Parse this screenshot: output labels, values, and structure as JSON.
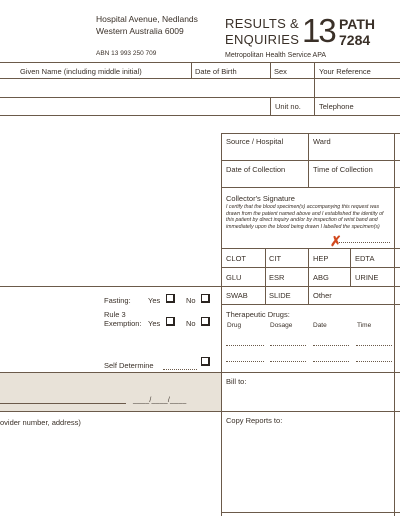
{
  "header": {
    "address_line1": "Hospital Avenue, Nedlands",
    "address_line2": "Western Australia 6009",
    "abn": "ABN 13 993 250 709",
    "title_line1": "RESULTS &",
    "title_line2": "ENQUIRIES",
    "big_number": "13",
    "path_label": "PATH",
    "path_number": "7284",
    "service": "Metropolitan Health Service APA"
  },
  "patient_row": {
    "given_name": "Given Name (including middle initial)",
    "dob": "Date of Birth",
    "sex": "Sex",
    "reference": "Your Reference",
    "unit_no": "Unit no.",
    "telephone": "Telephone"
  },
  "right_panel": {
    "source_hospital": "Source / Hospital",
    "ward": "Ward",
    "date_collection": "Date of Collection",
    "time_collection": "Time of Collection",
    "collector_signature": "Collector's Signature",
    "certify_text": "I certify that the blood specimen(s) accompanying this request was drawn from the patient named above and I established the identity of this patient by direct inquiry and/or by inspection of wrist band and immediately upon the blood being drawn I labelled the specimen(s)",
    "tubes": [
      "CLOT",
      "CIT",
      "HEP",
      "EDTA",
      "GLU",
      "ESR",
      "ABG",
      "URINE",
      "SWAB",
      "SLIDE",
      "Other"
    ],
    "therapeutic_drugs": "Therapeutic Drugs:",
    "drug_cols": [
      "Drug",
      "Dosage",
      "Date",
      "Time"
    ],
    "bill_to": "Bill to:",
    "copy_reports": "Copy Reports to:"
  },
  "left_panel": {
    "fasting": "Fasting:",
    "yes": "Yes",
    "no": "No",
    "rule3_line1": "Rule 3",
    "rule3_line2": "Exemption:",
    "self_determine": "Self Determine",
    "date_slashes": "____/____/____",
    "provider": "ovider number, address)"
  },
  "colors": {
    "line": "#6b5a4a",
    "shade": "#e8e2d8",
    "mark": "#d2491e"
  }
}
